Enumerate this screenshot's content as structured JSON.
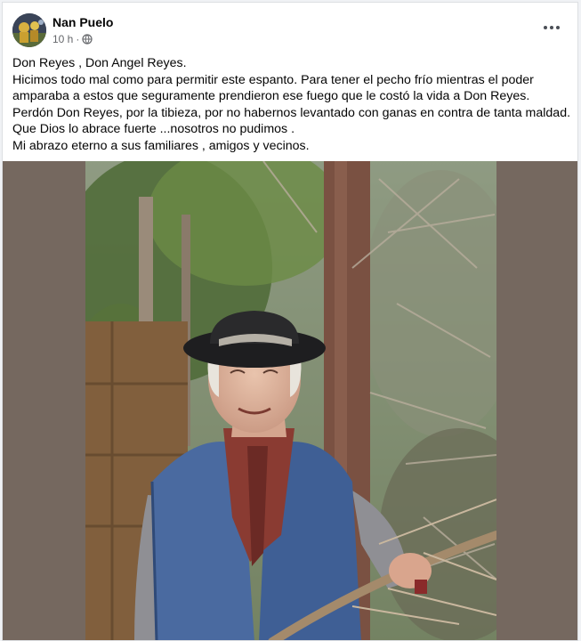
{
  "post": {
    "author": "Nan Puelo",
    "time": "10 h",
    "separator": "·",
    "privacy_icon": "globe-icon",
    "more_icon": "more-horizontal-icon",
    "text_lines": [
      "Don Reyes , Don Angel Reyes.",
      "Hicimos todo mal como para permitir este espanto. Para tener el pecho frío mientras el poder",
      "amparaba a estos que seguramente prendieron ese fuego que le costó la vida a Don Reyes.",
      "Perdón Don Reyes, por la tibieza, por no habernos levantado con ganas en contra de tanta maldad.",
      "Que Dios lo abrace fuerte ...nosotros no pudimos .",
      "Mi abrazo eterno a sus familiares , amigos y vecinos."
    ]
  },
  "colors": {
    "photo_backdrop": "#75685f",
    "meta_text": "#65676b"
  }
}
